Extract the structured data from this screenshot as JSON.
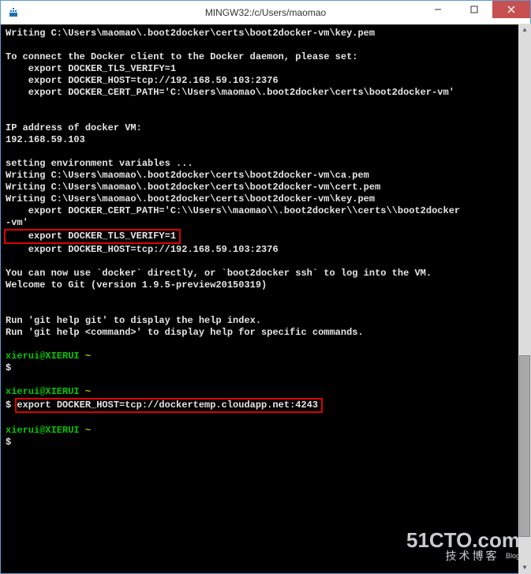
{
  "window": {
    "title": "MINGW32:/c/Users/maomao"
  },
  "terminal": {
    "lines": [
      {
        "t": "white",
        "txt": "Writing C:\\Users\\maomao\\.boot2docker\\certs\\boot2docker-vm\\key.pem"
      },
      {
        "t": "white",
        "txt": ""
      },
      {
        "t": "white",
        "txt": "To connect the Docker client to the Docker daemon, please set:"
      },
      {
        "t": "white",
        "txt": "    export DOCKER_TLS_VERIFY=1"
      },
      {
        "t": "white",
        "txt": "    export DOCKER_HOST=tcp://192.168.59.103:2376"
      },
      {
        "t": "white",
        "txt": "    export DOCKER_CERT_PATH='C:\\Users\\maomao\\.boot2docker\\certs\\boot2docker-vm'"
      },
      {
        "t": "white",
        "txt": ""
      },
      {
        "t": "white",
        "txt": ""
      },
      {
        "t": "white",
        "txt": "IP address of docker VM:"
      },
      {
        "t": "white",
        "txt": "192.168.59.103"
      },
      {
        "t": "white",
        "txt": ""
      },
      {
        "t": "white",
        "txt": "setting environment variables ..."
      },
      {
        "t": "white",
        "txt": "Writing C:\\Users\\maomao\\.boot2docker\\certs\\boot2docker-vm\\ca.pem"
      },
      {
        "t": "white",
        "txt": "Writing C:\\Users\\maomao\\.boot2docker\\certs\\boot2docker-vm\\cert.pem"
      },
      {
        "t": "white",
        "txt": "Writing C:\\Users\\maomao\\.boot2docker\\certs\\boot2docker-vm\\key.pem"
      },
      {
        "t": "white",
        "txt": "    export DOCKER_CERT_PATH='C:\\\\Users\\\\maomao\\\\.boot2docker\\\\certs\\\\boot2docker"
      },
      {
        "t": "white",
        "txt": "-vm'"
      },
      {
        "t": "hl1",
        "txt": "    export DOCKER_TLS_VERIFY=1"
      },
      {
        "t": "white",
        "txt": "    export DOCKER_HOST=tcp://192.168.59.103:2376"
      },
      {
        "t": "white",
        "txt": ""
      },
      {
        "t": "white",
        "txt": "You can now use `docker` directly, or `boot2docker ssh` to log into the VM."
      },
      {
        "t": "white",
        "txt": "Welcome to Git (version 1.9.5-preview20150319)"
      },
      {
        "t": "white",
        "txt": ""
      },
      {
        "t": "white",
        "txt": ""
      },
      {
        "t": "white",
        "txt": "Run 'git help git' to display the help index."
      },
      {
        "t": "white",
        "txt": "Run 'git help <command>' to display help for specific commands."
      },
      {
        "t": "white",
        "txt": ""
      },
      {
        "t": "prompt",
        "user": "xierui@XIERUI ",
        "path": "~"
      },
      {
        "t": "white",
        "txt": "$"
      },
      {
        "t": "white",
        "txt": ""
      },
      {
        "t": "prompt",
        "user": "xierui@XIERUI ",
        "path": "~"
      },
      {
        "t": "hl2",
        "prefix": "$ ",
        "txt": "export DOCKER_HOST=tcp://dockertemp.cloudapp.net:4243"
      },
      {
        "t": "white",
        "txt": ""
      },
      {
        "t": "prompt",
        "user": "xierui@XIERUI ",
        "path": "~"
      },
      {
        "t": "white",
        "txt": "$"
      }
    ]
  },
  "watermark": {
    "line1": "51CTO.com",
    "line2": "技术博客",
    "badge": "Blog"
  }
}
